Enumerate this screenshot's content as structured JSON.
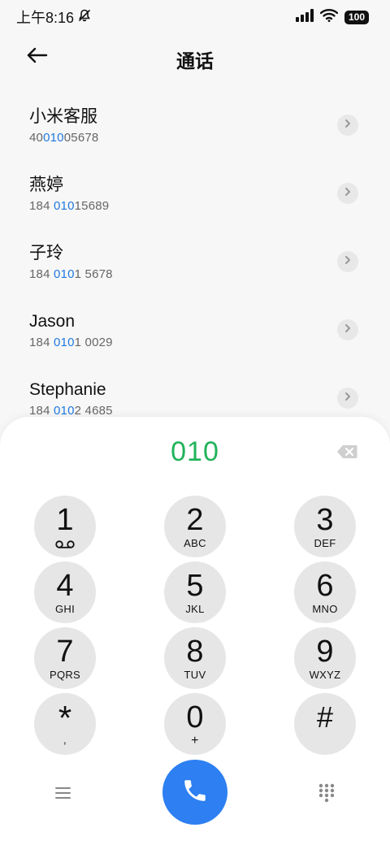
{
  "status_bar": {
    "time": "上午8:16",
    "battery": "100"
  },
  "header": {
    "title": "通话"
  },
  "contacts": [
    {
      "name": "小米客服",
      "number_pre": "40",
      "number_match": "010",
      "number_post": "05678"
    },
    {
      "name": "燕婷",
      "number_pre": "184 ",
      "number_match": "010",
      "number_post": "15689"
    },
    {
      "name": "子玲",
      "number_pre": "184 ",
      "number_match": "010",
      "number_post": "1 5678"
    },
    {
      "name": "Jason",
      "number_pre": "184 ",
      "number_match": "010",
      "number_post": "1 0029"
    },
    {
      "name": "Stephanie",
      "number_pre": "184 ",
      "number_match": "010",
      "number_post": "2 4685"
    }
  ],
  "dialer": {
    "input": "010",
    "keys": [
      {
        "digit": "1",
        "letters": ""
      },
      {
        "digit": "2",
        "letters": "ABC"
      },
      {
        "digit": "3",
        "letters": "DEF"
      },
      {
        "digit": "4",
        "letters": "GHI"
      },
      {
        "digit": "5",
        "letters": "JKL"
      },
      {
        "digit": "6",
        "letters": "MNO"
      },
      {
        "digit": "7",
        "letters": "PQRS"
      },
      {
        "digit": "8",
        "letters": "TUV"
      },
      {
        "digit": "9",
        "letters": "WXYZ"
      },
      {
        "digit": "*",
        "letters": ","
      },
      {
        "digit": "0",
        "letters": "+"
      },
      {
        "digit": "#",
        "letters": ""
      }
    ]
  },
  "colors": {
    "match_highlight": "#1f7ae0",
    "dial_input": "#20b35a",
    "call_button": "#2d7ff2"
  },
  "icons": {
    "key_1_sub": "voicemail-icon",
    "back": "arrow-left-icon",
    "delete": "backspace-icon",
    "call": "phone-icon",
    "menu": "menu-icon",
    "keypad": "dialpad-icon"
  }
}
